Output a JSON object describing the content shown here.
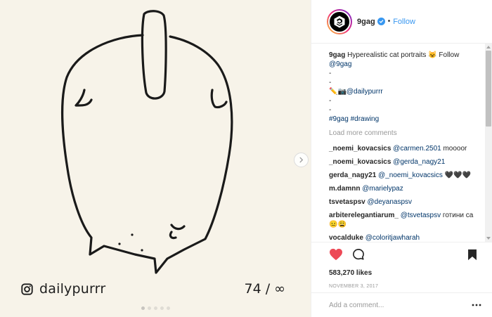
{
  "media": {
    "watermark_handle": "dailypurrr",
    "counter": "74 / ∞",
    "icons": [
      "instagram-icon",
      "chevron-right-icon"
    ]
  },
  "header": {
    "username": "9gag",
    "separator": "•",
    "follow_label": "Follow"
  },
  "caption": {
    "username": "9gag",
    "text": "Hyperealistic cat portraits 😺 Follow",
    "mention": "@9gag",
    "line_dash_1": "-",
    "line_dash_2": "-",
    "emoji_prefix": "✏️📷",
    "credit_mention": "@dailypurrr",
    "line_dash_3": "-",
    "line_dash_4": "-",
    "hashtag_1": "#9gag",
    "hashtag_2": "#drawing"
  },
  "load_more_label": "Load more comments",
  "comments": [
    {
      "user": "_noemi_kovacsics",
      "mention": "@carmen.2501",
      "text": " moooor"
    },
    {
      "user": "_noemi_kovacsics",
      "mention": "@gerda_nagy21",
      "text": ""
    },
    {
      "user": "gerda_nagy21",
      "mention": "@_noemi_kovacsics",
      "text": " 🖤🖤🖤"
    },
    {
      "user": "m.damnn",
      "mention": "@marielypaz",
      "text": ""
    },
    {
      "user": "tsvetaspsv",
      "mention": "@deyanaspsv",
      "text": ""
    },
    {
      "user": "arbiterelegantiarum_",
      "mention": "@tsvetaspsv",
      "text": " готини са 😐😩"
    },
    {
      "user": "vocalduke",
      "mention": "@coloritjawharah",
      "text": ""
    }
  ],
  "actions": {
    "likes": "583,270 likes",
    "date": "NOVEMBER 3, 2017",
    "icons": [
      "heart-icon",
      "comment-icon",
      "bookmark-icon"
    ],
    "like_color": "#ed4956"
  },
  "add_comment": {
    "placeholder": "Add a comment..."
  },
  "colors": {
    "link": "#003569",
    "follow": "#3897f0",
    "muted": "#999999",
    "media_bg": "#f7f3e9"
  }
}
